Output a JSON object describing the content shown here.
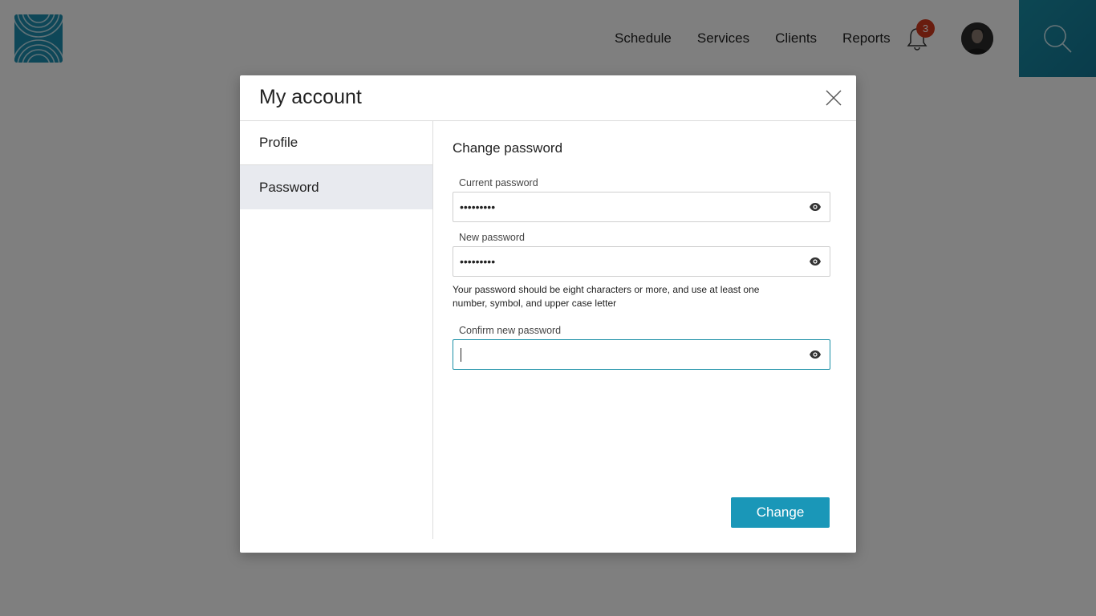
{
  "header": {
    "nav": [
      "Schedule",
      "Services",
      "Clients",
      "Reports"
    ],
    "notification_count": "3",
    "icons": {
      "logo": "logo-icon",
      "bell": "bell-icon",
      "avatar": "avatar",
      "search": "search-icon"
    }
  },
  "modal": {
    "title": "My account",
    "sidebar": {
      "items": [
        {
          "label": "Profile",
          "active": false
        },
        {
          "label": "Password",
          "active": true
        }
      ]
    },
    "section_title": "Change password",
    "fields": {
      "current": {
        "label": "Current password",
        "value": "•••••••••"
      },
      "new": {
        "label": "New password",
        "value": "•••••••••"
      },
      "confirm": {
        "label": "Confirm new password",
        "value": ""
      }
    },
    "hint": "Your password should be eight characters or more, and use at least one number, symbol, and upper case letter",
    "submit_label": "Change"
  },
  "colors": {
    "accent": "#1a97b8",
    "focus_border": "#1a8fa6",
    "badge": "#d23a1f",
    "search_tile": "#137896"
  }
}
